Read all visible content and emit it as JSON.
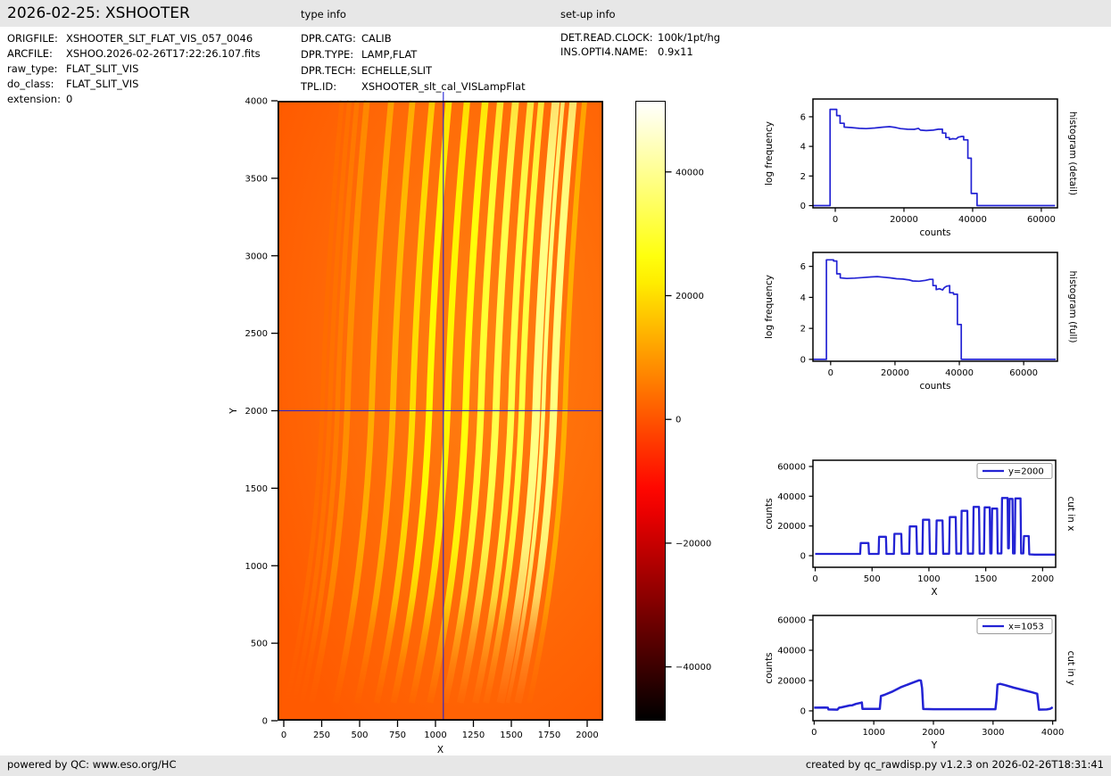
{
  "header": {
    "title": "2026-02-25: XSHOOTER",
    "type_info_label": "type info",
    "setup_info_label": "set-up info"
  },
  "file_info": {
    "rows": [
      {
        "label": "ORIGFILE:",
        "value": "XSHOOTER_SLT_FLAT_VIS_057_0046"
      },
      {
        "label": "ARCFILE:",
        "value": "XSHOO.2026-02-26T17:22:26.107.fits"
      },
      {
        "label": "raw_type:",
        "value": "FLAT_SLIT_VIS"
      },
      {
        "label": "do_class:",
        "value": "FLAT_SLIT_VIS"
      },
      {
        "label": "extension:",
        "value": "0"
      }
    ]
  },
  "type_info": {
    "rows": [
      {
        "label": "DPR.CATG:",
        "value": "CALIB"
      },
      {
        "label": "DPR.TYPE:",
        "value": "LAMP,FLAT"
      },
      {
        "label": "DPR.TECH:",
        "value": "ECHELLE,SLIT"
      },
      {
        "label": "TPL.ID:",
        "value": "XSHOOTER_slt_cal_VISLampFlat"
      }
    ]
  },
  "setup_info": {
    "rows": [
      {
        "label": "DET.READ.CLOCK:",
        "value": "100k/1pt/hg"
      },
      {
        "label": "INS.OPTI4.NAME:",
        "value": "0.9x11"
      }
    ]
  },
  "footer": {
    "left": "powered by QC: www.eso.org/HC",
    "right": "created by qc_rawdisp.py v1.2.3 on 2026-02-26T18:31:41"
  },
  "colors": {
    "accent_blue": "#2323d4",
    "band_gray": "#e7e7e7",
    "axis_black": "#000000"
  },
  "chart_data": [
    {
      "id": "detector_image",
      "type": "heatmap",
      "xlabel": "X",
      "ylabel": "Y",
      "xlim": [
        -40,
        2105
      ],
      "ylim": [
        0,
        4000
      ],
      "x_ticks": [
        0,
        250,
        500,
        750,
        1000,
        1250,
        1500,
        1750,
        2000
      ],
      "y_ticks": [
        0,
        500,
        1000,
        1500,
        2000,
        2500,
        3000,
        3500,
        4000
      ],
      "colormap": "hot",
      "vmin": -48700,
      "vmax": 51500,
      "colorbar_ticks": [
        40000,
        20000,
        0,
        -20000,
        -40000
      ],
      "crosshair": {
        "x": 1053,
        "y": 2000
      },
      "background_counts": 900,
      "orders_note": "echelle order stripes: [x position at y=2000, peak counts, width in detector pixels]; orders curve bottom-left to top-right and fade out below y~700",
      "orders": [
        [
          255,
          3600,
          30
        ],
        [
          305,
          4300,
          30
        ],
        [
          355,
          5600,
          32
        ],
        [
          420,
          8500,
          40
        ],
        [
          580,
          12700,
          40
        ],
        [
          720,
          14700,
          40
        ],
        [
          850,
          19700,
          40
        ],
        [
          960,
          24200,
          42
        ],
        [
          1080,
          23700,
          42
        ],
        [
          1200,
          26000,
          44
        ],
        [
          1300,
          30200,
          44
        ],
        [
          1400,
          32800,
          46
        ],
        [
          1500,
          32500,
          44
        ],
        [
          1570,
          31700,
          40
        ],
        [
          1665,
          38800,
          52
        ],
        [
          1712,
          38200,
          26
        ],
        [
          1780,
          38500,
          48
        ],
        [
          1855,
          13200,
          34
        ]
      ]
    },
    {
      "id": "histogram_detail",
      "type": "line",
      "right_label": "histogram (detail)",
      "xlabel": "counts",
      "ylabel": "log frequency",
      "xlim": [
        -6500,
        64700
      ],
      "ylim": [
        -0.15,
        7.2
      ],
      "x_ticks": [
        0,
        20000,
        40000,
        60000
      ],
      "y_ticks": [
        0,
        2,
        4,
        6
      ],
      "points": [
        [
          -6500,
          0
        ],
        [
          -1500,
          0
        ],
        [
          -1500,
          6.5
        ],
        [
          400,
          6.5
        ],
        [
          400,
          6.08
        ],
        [
          1400,
          6.08
        ],
        [
          1400,
          5.56
        ],
        [
          2600,
          5.56
        ],
        [
          2600,
          5.3
        ],
        [
          4600,
          5.27
        ],
        [
          7000,
          5.22
        ],
        [
          9000,
          5.2
        ],
        [
          11500,
          5.24
        ],
        [
          14000,
          5.3
        ],
        [
          15800,
          5.33
        ],
        [
          17500,
          5.28
        ],
        [
          19000,
          5.2
        ],
        [
          21000,
          5.16
        ],
        [
          23000,
          5.15
        ],
        [
          24200,
          5.22
        ],
        [
          24800,
          5.1
        ],
        [
          26500,
          5.07
        ],
        [
          28500,
          5.1
        ],
        [
          30000,
          5.16
        ],
        [
          31200,
          5.16
        ],
        [
          31200,
          4.9
        ],
        [
          32200,
          4.9
        ],
        [
          32200,
          4.6
        ],
        [
          33200,
          4.6
        ],
        [
          33200,
          4.47
        ],
        [
          34200,
          4.52
        ],
        [
          35200,
          4.5
        ],
        [
          35800,
          4.62
        ],
        [
          36800,
          4.67
        ],
        [
          37400,
          4.67
        ],
        [
          37400,
          4.44
        ],
        [
          38600,
          4.44
        ],
        [
          38600,
          3.2
        ],
        [
          39600,
          3.2
        ],
        [
          39600,
          0.82
        ],
        [
          41300,
          0.82
        ],
        [
          41300,
          0
        ],
        [
          64000,
          0
        ]
      ]
    },
    {
      "id": "histogram_full",
      "type": "line",
      "right_label": "histogram (full)",
      "xlabel": "counts",
      "ylabel": "log frequency",
      "xlim": [
        -5500,
        70500
      ],
      "ylim": [
        -0.12,
        6.9
      ],
      "x_ticks": [
        0,
        20000,
        40000,
        60000
      ],
      "y_ticks": [
        0,
        2,
        4,
        6
      ],
      "points": [
        [
          -5500,
          0
        ],
        [
          -1300,
          0
        ],
        [
          -1300,
          6.42
        ],
        [
          900,
          6.42
        ],
        [
          900,
          6.35
        ],
        [
          1900,
          6.35
        ],
        [
          1900,
          5.52
        ],
        [
          3000,
          5.52
        ],
        [
          3000,
          5.26
        ],
        [
          5000,
          5.22
        ],
        [
          7500,
          5.24
        ],
        [
          10000,
          5.28
        ],
        [
          12500,
          5.32
        ],
        [
          14500,
          5.34
        ],
        [
          16500,
          5.3
        ],
        [
          18500,
          5.26
        ],
        [
          20500,
          5.2
        ],
        [
          22500,
          5.18
        ],
        [
          24500,
          5.12
        ],
        [
          25500,
          5.06
        ],
        [
          27500,
          5.04
        ],
        [
          29500,
          5.1
        ],
        [
          30800,
          5.16
        ],
        [
          31800,
          5.16
        ],
        [
          31800,
          4.76
        ],
        [
          32800,
          4.76
        ],
        [
          32800,
          4.5
        ],
        [
          33800,
          4.56
        ],
        [
          34800,
          4.48
        ],
        [
          35300,
          4.62
        ],
        [
          36000,
          4.72
        ],
        [
          37000,
          4.76
        ],
        [
          37000,
          4.3
        ],
        [
          38200,
          4.3
        ],
        [
          38200,
          4.2
        ],
        [
          39400,
          4.2
        ],
        [
          39400,
          2.25
        ],
        [
          40600,
          2.25
        ],
        [
          40600,
          0
        ],
        [
          70000,
          0
        ]
      ]
    },
    {
      "id": "cut_in_x",
      "type": "line",
      "right_label": "cut in x",
      "legend": "y=2000",
      "xlabel": "X",
      "ylabel": "counts",
      "xlim": [
        -20,
        2115
      ],
      "ylim": [
        -7800,
        64200
      ],
      "x_ticks": [
        0,
        500,
        1000,
        1500,
        2000
      ],
      "y_ticks": [
        0,
        20000,
        40000,
        60000
      ],
      "points": [
        [
          0,
          1200
        ],
        [
          395,
          1200
        ],
        [
          400,
          8500
        ],
        [
          468,
          8500
        ],
        [
          473,
          1200
        ],
        [
          558,
          1200
        ],
        [
          562,
          12700
        ],
        [
          622,
          12700
        ],
        [
          627,
          1200
        ],
        [
          692,
          1200
        ],
        [
          697,
          14700
        ],
        [
          757,
          14700
        ],
        [
          762,
          1300
        ],
        [
          827,
          1300
        ],
        [
          832,
          19700
        ],
        [
          890,
          19700
        ],
        [
          895,
          1300
        ],
        [
          943,
          1300
        ],
        [
          948,
          24200
        ],
        [
          1003,
          24200
        ],
        [
          1008,
          1300
        ],
        [
          1063,
          1300
        ],
        [
          1068,
          23700
        ],
        [
          1120,
          23700
        ],
        [
          1125,
          1300
        ],
        [
          1178,
          1300
        ],
        [
          1183,
          26000
        ],
        [
          1236,
          26000
        ],
        [
          1241,
          1400
        ],
        [
          1283,
          1400
        ],
        [
          1288,
          30200
        ],
        [
          1338,
          30200
        ],
        [
          1343,
          1400
        ],
        [
          1388,
          1400
        ],
        [
          1393,
          32800
        ],
        [
          1441,
          32800
        ],
        [
          1446,
          1400
        ],
        [
          1485,
          1400
        ],
        [
          1490,
          32500
        ],
        [
          1535,
          32500
        ],
        [
          1540,
          1500
        ],
        [
          1551,
          1500
        ],
        [
          1556,
          31700
        ],
        [
          1600,
          31700
        ],
        [
          1605,
          1500
        ],
        [
          1638,
          1500
        ],
        [
          1643,
          38800
        ],
        [
          1692,
          38800
        ],
        [
          1697,
          5000
        ],
        [
          1704,
          5000
        ],
        [
          1709,
          38200
        ],
        [
          1735,
          38200
        ],
        [
          1740,
          1500
        ],
        [
          1755,
          1500
        ],
        [
          1760,
          38500
        ],
        [
          1806,
          38500
        ],
        [
          1811,
          1500
        ],
        [
          1831,
          1500
        ],
        [
          1836,
          13200
        ],
        [
          1878,
          13200
        ],
        [
          1883,
          900
        ],
        [
          1930,
          700
        ],
        [
          2110,
          700
        ]
      ]
    },
    {
      "id": "cut_in_y",
      "type": "line",
      "right_label": "cut in y",
      "legend": "x=1053",
      "xlabel": "Y",
      "ylabel": "counts",
      "xlim": [
        -20,
        4050
      ],
      "ylim": [
        -6500,
        63000
      ],
      "x_ticks": [
        0,
        1000,
        2000,
        3000,
        4000
      ],
      "y_ticks": [
        0,
        20000,
        40000,
        60000
      ],
      "points": [
        [
          0,
          2100
        ],
        [
          180,
          2200
        ],
        [
          230,
          2100
        ],
        [
          240,
          900
        ],
        [
          390,
          800
        ],
        [
          420,
          2100
        ],
        [
          450,
          2300
        ],
        [
          600,
          3600
        ],
        [
          640,
          3700
        ],
        [
          700,
          4600
        ],
        [
          790,
          5400
        ],
        [
          800,
          5600
        ],
        [
          810,
          1300
        ],
        [
          1100,
          1300
        ],
        [
          1120,
          9800
        ],
        [
          1180,
          10600
        ],
        [
          1300,
          12500
        ],
        [
          1450,
          15500
        ],
        [
          1600,
          17800
        ],
        [
          1700,
          19300
        ],
        [
          1760,
          20200
        ],
        [
          1790,
          20000
        ],
        [
          1810,
          15000
        ],
        [
          1830,
          1200
        ],
        [
          2000,
          1100
        ],
        [
          3040,
          1100
        ],
        [
          3060,
          8000
        ],
        [
          3075,
          17300
        ],
        [
          3120,
          17800
        ],
        [
          3200,
          17000
        ],
        [
          3350,
          15300
        ],
        [
          3500,
          13800
        ],
        [
          3650,
          12300
        ],
        [
          3740,
          11300
        ],
        [
          3755,
          6000
        ],
        [
          3770,
          800
        ],
        [
          3900,
          900
        ],
        [
          3960,
          1400
        ],
        [
          4000,
          2400
        ]
      ]
    }
  ]
}
